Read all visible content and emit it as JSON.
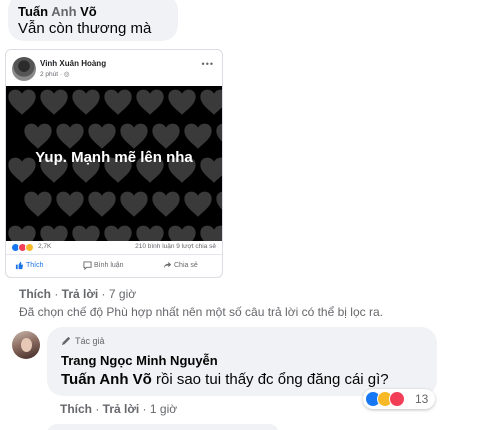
{
  "comment1": {
    "author_first": "Tuấn",
    "author_mid": "Anh",
    "author_last": "Võ",
    "text": "Vẫn còn thương mà",
    "like_label": "Thích",
    "reply_label": "Trả lời",
    "time": "7 giờ"
  },
  "shared_post": {
    "author": "Vinh Xuân Hoàng",
    "time": "2 phút",
    "caption": "Yup. Mạnh mẽ lên nha",
    "reaction_count": "2,7K",
    "comments_shares": "210 bình luận  9 lượt chia sẻ",
    "actions": {
      "like": "Thích",
      "comment": "Bình luận",
      "share": "Chia sẻ"
    },
    "colors": {
      "background": "#000000",
      "hearts": "#3a3a3a"
    }
  },
  "filter_note": "Đã chọn chế độ Phù hợp nhất nên một số câu trả lời có thể bị lọc ra.",
  "reply": {
    "author_badge": "Tác giả",
    "author": "Trang Ngọc Minh Nguyễn",
    "mention": "Tuấn Anh Võ",
    "text": " rồi sao tui thấy đc ổng đăng cái gì?",
    "reaction_count": "13",
    "like_label": "Thích",
    "reply_label": "Trả lời",
    "time": "1 giờ"
  },
  "icons": [
    "pencil-icon",
    "globe-icon",
    "like-thumb-icon",
    "comment-icon",
    "share-icon",
    "like-reaction-icon",
    "care-reaction-icon",
    "heart-reaction-icon"
  ]
}
